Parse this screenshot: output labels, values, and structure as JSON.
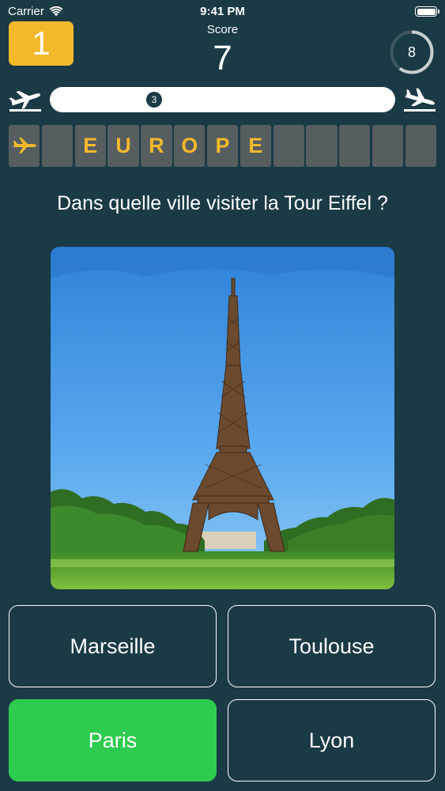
{
  "status_bar": {
    "carrier": "Carrier",
    "time": "9:41 PM"
  },
  "header": {
    "level": "1",
    "score_label": "Score",
    "score_value": "7",
    "timer_value": "8",
    "accent_color": "#f4b82b"
  },
  "progress": {
    "position": "3",
    "fraction": 0.3
  },
  "tiles": [
    "",
    "",
    "E",
    "U",
    "R",
    "O",
    "P",
    "E",
    "",
    "",
    "",
    "",
    ""
  ],
  "question": "Dans quelle ville visiter la Tour Eiffel ?",
  "answers": [
    {
      "label": "Marseille",
      "state": "default"
    },
    {
      "label": "Toulouse",
      "state": "default"
    },
    {
      "label": "Paris",
      "state": "correct"
    },
    {
      "label": "Lyon",
      "state": "default"
    }
  ],
  "colors": {
    "background": "#1a3a45",
    "correct": "#2ecb4f",
    "tile": "#565e60"
  }
}
